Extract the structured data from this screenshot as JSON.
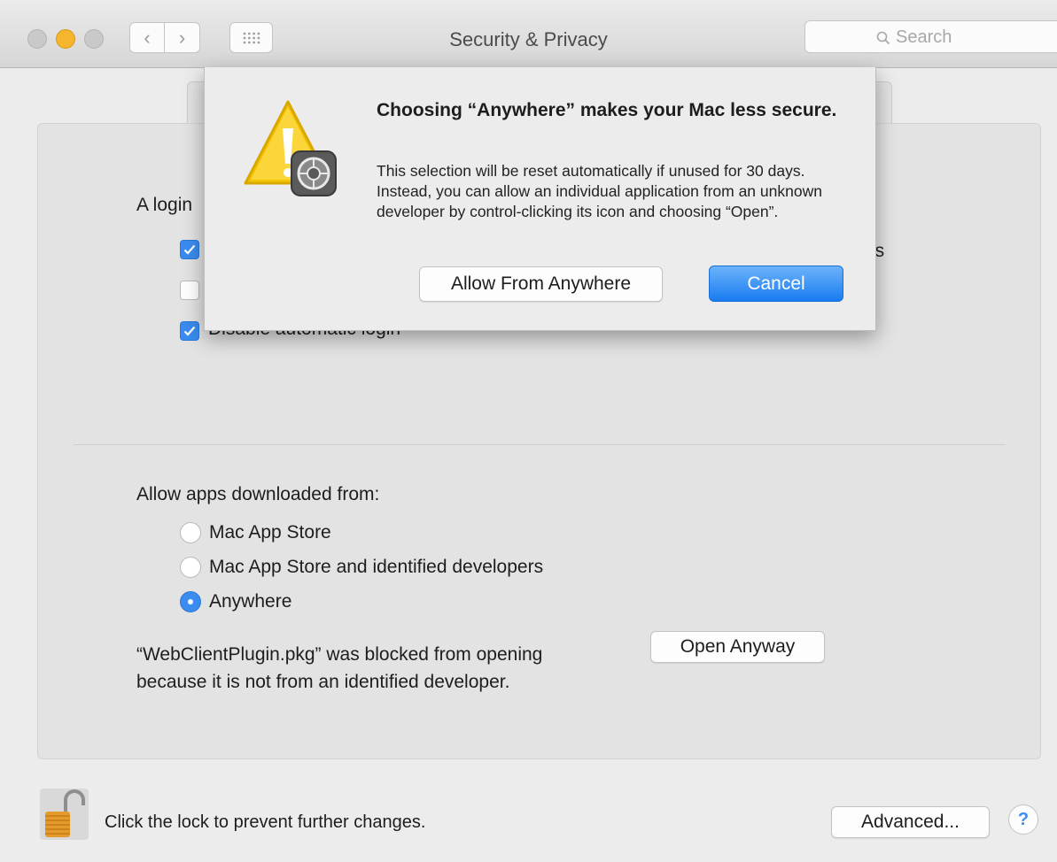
{
  "window": {
    "title": "Security & Privacy",
    "search_placeholder": "Search"
  },
  "login_section": {
    "label": "A login",
    "checkboxes": [
      {
        "label": "",
        "checked": true
      },
      {
        "label": "",
        "checked": false
      },
      {
        "label": "Disable automatic login",
        "checked": true
      }
    ],
    "partial_text_right": "ns"
  },
  "gatekeeper": {
    "label": "Allow apps downloaded from:",
    "options": [
      {
        "label": "Mac App Store",
        "selected": false
      },
      {
        "label": "Mac App Store and identified developers",
        "selected": false
      },
      {
        "label": "Anywhere",
        "selected": true
      }
    ],
    "blocked_message_line1": "“WebClientPlugin.pkg” was blocked from opening",
    "blocked_message_line2": "because it is not from an identified developer.",
    "open_anyway_label": "Open Anyway"
  },
  "footer": {
    "lock_text": "Click the lock to prevent further changes.",
    "advanced_label": "Advanced...",
    "help_label": "?"
  },
  "alert": {
    "title": "Choosing “Anywhere” makes your Mac less secure.",
    "body": "This selection will be reset automatically if unused for 30 days. Instead, you can allow an individual application from an unknown developer by control-clicking its icon and choosing “Open”.",
    "allow_label": "Allow From Anywhere",
    "cancel_label": "Cancel"
  },
  "colors": {
    "accent": "#3a8cf0",
    "warning": "#f5c400",
    "minimize": "#f5b52c"
  }
}
